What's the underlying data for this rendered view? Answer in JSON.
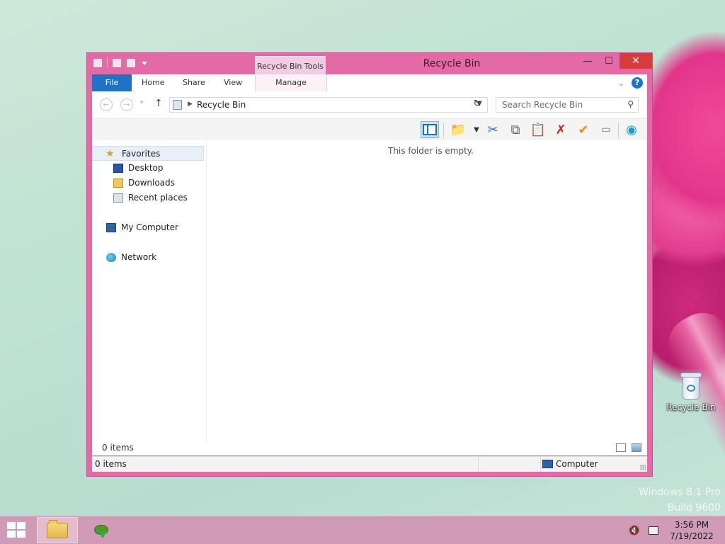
{
  "window": {
    "title": "Recycle Bin",
    "tool_tab": "Recycle Bin Tools",
    "min": "—",
    "max": "☐",
    "close": "✕"
  },
  "ribbon": {
    "tabs": [
      "File",
      "Home",
      "Share",
      "View",
      "Manage"
    ],
    "help": "?",
    "collapse": "⌄"
  },
  "nav": {
    "back": "←",
    "forward": "→",
    "recent": "▾",
    "up": "↑",
    "address": "Recycle Bin",
    "refresh": "↻",
    "search_placeholder": "Search Recycle Bin",
    "search_icon": "search-icon"
  },
  "sidebar": {
    "favorites": "Favorites",
    "items": [
      "Desktop",
      "Downloads",
      "Recent places"
    ],
    "computer": "My Computer",
    "network": "Network"
  },
  "content": {
    "empty_text": "This folder is empty."
  },
  "status": {
    "items_inner": "0 items",
    "items_bar": "0 items",
    "location": "Computer"
  },
  "desktop": {
    "icon_label": "Recycle Bin",
    "watermark_line1": "Windows 8.1 Pro",
    "watermark_line2": "Build 9600"
  },
  "taskbar": {
    "time": "3:56 PM",
    "date": "7/19/2022"
  },
  "colors": {
    "window_frame": "#e36aa7",
    "file_tab": "#1e73c7",
    "taskbar": "#cf9bb6"
  }
}
